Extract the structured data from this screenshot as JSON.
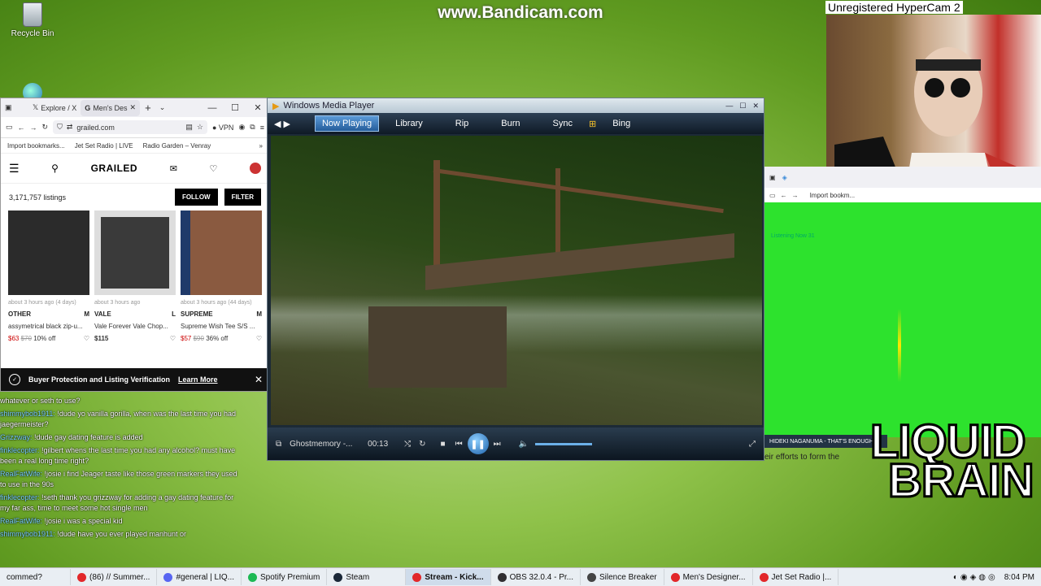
{
  "desktop": {
    "watermark": "www.Bandicam.com",
    "hypercam": "Unregistered HyperCam 2",
    "recycle_bin": "Recycle Bin"
  },
  "browser": {
    "tabs": [
      "Explore / X",
      "Men's Des"
    ],
    "url": "grailed.com",
    "vpn": "VPN",
    "bookmarks": [
      "Import bookmarks...",
      "Jet Set Radio | LIVE",
      "Radio Garden – Venray"
    ],
    "site_logo": "GRAILED",
    "listing_count": "3,171,757 listings",
    "follow_label": "FOLLOW",
    "filter_label": "FILTER",
    "listings": [
      {
        "meta": "about 3 hours ago  (4 days)",
        "brand": "OTHER",
        "size": "M",
        "title": "assymetrical black zip-u...",
        "price": "$63",
        "old_price": "$70",
        "discount": "10% off",
        "thumb": "#2b2b2b"
      },
      {
        "meta": "about 3 hours ago",
        "brand": "VALE",
        "size": "L",
        "title": "Vale Forever Vale Chop...",
        "price": "$115",
        "old_price": "",
        "discount": "",
        "thumb": "#3a3a3a"
      },
      {
        "meta": "about 3 hours ago  (44 days)",
        "brand": "SUPREME",
        "size": "M",
        "title": "Supreme Wish Tee S/S ...",
        "price": "$57",
        "old_price": "$90",
        "discount": "36% off",
        "thumb": "#8a5a40"
      }
    ],
    "banner_text": "Buyer Protection and Listing Verification",
    "banner_link": "Learn More"
  },
  "wmp": {
    "title": "Windows Media Player",
    "nav": [
      "Now Playing",
      "Library",
      "Rip",
      "Burn",
      "Sync",
      "Bing"
    ],
    "track": "Ghostmemory -...",
    "time": "00:13"
  },
  "green_app": {
    "bookmark": "Import bookm...",
    "listening": "Listening Now 31",
    "notice": "HIDEKI NAGANUMA - THAT'S ENOUGH",
    "efforts": "eir efforts to form the"
  },
  "overlay": {
    "liquid": "LIQUID",
    "brain": "BRAIN"
  },
  "chat": [
    {
      "user": "",
      "text": "whatever or seth to use?"
    },
    {
      "user": "shimmybob1911:",
      "text": " !dude yo vanilla gorilla, when was the last time you had jaegermeister?"
    },
    {
      "user": "Grizzway:",
      "text": " !dude gay dating feature is added"
    },
    {
      "user": "finklecopter:",
      "text": " !gilbert whens the last time you had any alcohol? must have been a real long time right?"
    },
    {
      "user": "RealFatWife:",
      "text": " !josie i find Jeager taste like those green markers they used to use in the 90s"
    },
    {
      "user": "finklecopter:",
      "text": " !seth thank you grizzway for adding a gay dating feature for my far ass, time to meet some hot single men"
    },
    {
      "user": "RealFatWife:",
      "text": " !josie i was a special kid"
    },
    {
      "user": "shimmybob1911:",
      "text": " !dude have you ever played manhunt or"
    }
  ],
  "taskbar": {
    "items": [
      {
        "label": "(86) // Summer...",
        "color": "#e2272a"
      },
      {
        "label": "#general | LIQ...",
        "color": "#5865f2"
      },
      {
        "label": "Spotify Premium",
        "color": "#1db954"
      },
      {
        "label": "Steam",
        "color": "#1b2838"
      },
      {
        "label": "Stream - Kick...",
        "color": "#e2272a",
        "active": true
      },
      {
        "label": "OBS 32.0.4 - Pr...",
        "color": "#302e31"
      },
      {
        "label": "Silence Breaker",
        "color": "#444444"
      },
      {
        "label": "Men's Designer...",
        "color": "#e2272a"
      },
      {
        "label": "Jet Set Radio |...",
        "color": "#e2272a"
      }
    ],
    "clock": "8:04 PM",
    "left_label": "commed?"
  }
}
